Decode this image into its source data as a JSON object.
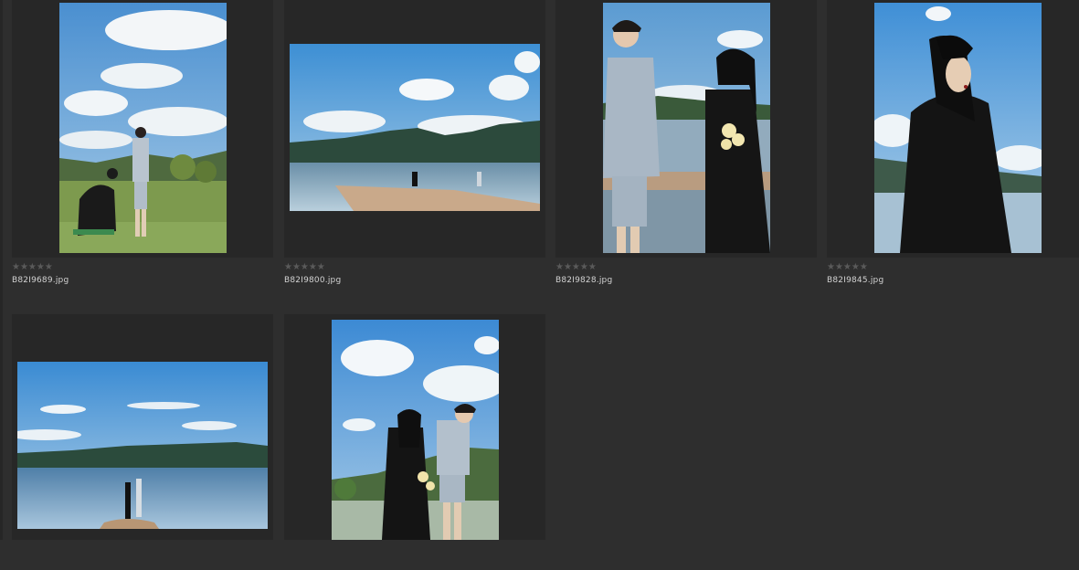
{
  "thumbnails": [
    {
      "filename": "B82I9689.jpg",
      "rating": "★★★★★"
    },
    {
      "filename": "B82I9800.jpg",
      "rating": "★★★★★"
    },
    {
      "filename": "B82I9828.jpg",
      "rating": "★★★★★"
    },
    {
      "filename": "B82I9845.jpg",
      "rating": "★★★★★"
    },
    {
      "filename": "",
      "rating": ""
    },
    {
      "filename": "",
      "rating": ""
    }
  ],
  "colors": {
    "background": "#2e2e2e",
    "cell": "#272727",
    "filename_text": "#d2d2d2",
    "stars": "#5a5a5a"
  }
}
